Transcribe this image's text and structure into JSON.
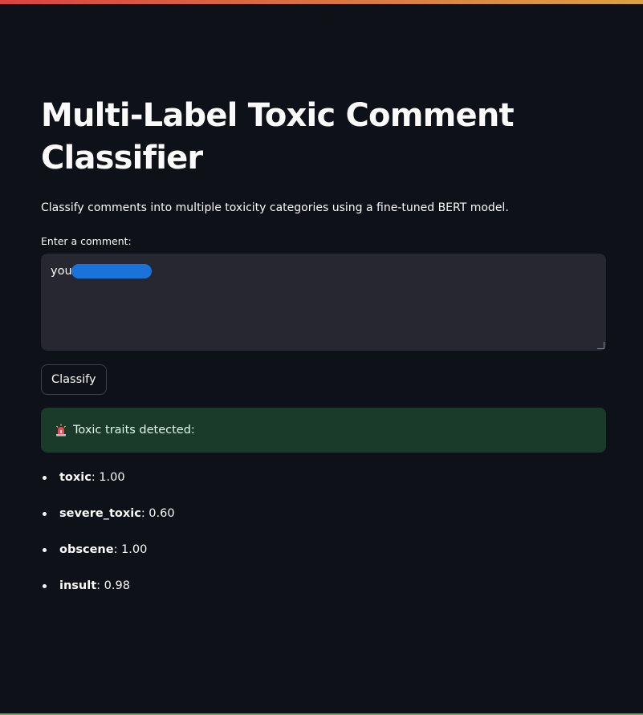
{
  "app": {
    "title": "Multi-Label Toxic Comment Classifier",
    "subtitle": "Classify comments into multiple toxicity categories using a fine-tuned BERT model."
  },
  "input": {
    "label": "Enter a comment:",
    "value": "you"
  },
  "button": {
    "label": "Classify"
  },
  "alert": {
    "icon": "rotating-light-icon",
    "text": "Toxic traits detected:"
  },
  "results": [
    {
      "label": "toxic",
      "value": ": 1.00"
    },
    {
      "label": "severe_toxic",
      "value": ": 0.60"
    },
    {
      "label": "obscene",
      "value": ": 1.00"
    },
    {
      "label": "insult",
      "value": ": 0.98"
    }
  ],
  "colors": {
    "background": "#0e1117",
    "input_bg": "#262730",
    "alert_bg": "#1a3a2a",
    "redaction": "#1a73d9"
  }
}
